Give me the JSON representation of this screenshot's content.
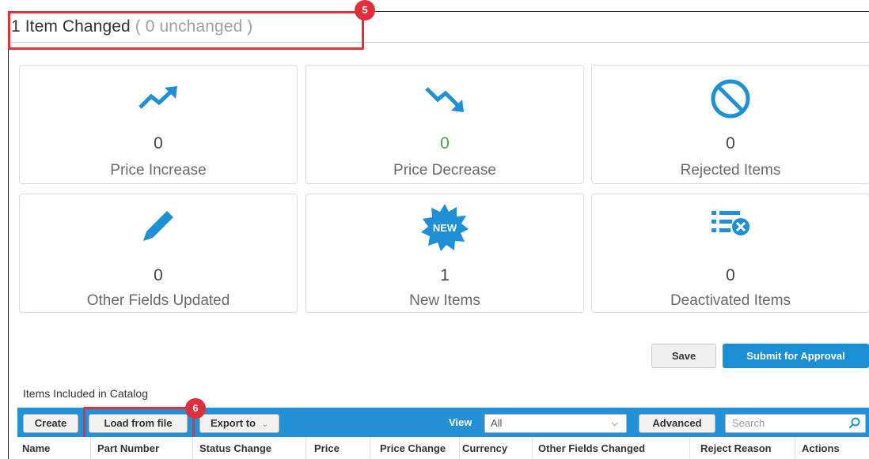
{
  "header": {
    "title_main": "1 Item Changed",
    "title_sub": " ( 0 unchanged )"
  },
  "callouts": [
    "5",
    "6"
  ],
  "tiles": [
    {
      "icon": "trend-up-icon",
      "count": "0",
      "label": "Price Increase"
    },
    {
      "icon": "trend-down-icon",
      "count": "0",
      "label": "Price Decrease"
    },
    {
      "icon": "prohibited-icon",
      "count": "0",
      "label": "Rejected Items"
    },
    {
      "icon": "pencil-icon",
      "count": "0",
      "label": "Other Fields Updated"
    },
    {
      "icon": "new-badge-icon",
      "count": "1",
      "label": "New Items",
      "badge_text": "NEW"
    },
    {
      "icon": "list-remove-icon",
      "count": "0",
      "label": "Deactivated Items"
    }
  ],
  "actions": {
    "save_label": "Save",
    "submit_label": "Submit for Approval"
  },
  "section_label": "Items Included in Catalog",
  "toolbar": {
    "create_label": "Create",
    "load_label": "Load from file",
    "export_label": "Export to",
    "view_label": "View",
    "view_value": "All",
    "advanced_label": "Advanced",
    "search_placeholder": "Search"
  },
  "table": {
    "columns": [
      "Name",
      "Part Number",
      "Status Change",
      "Price",
      "Price Change",
      "Currency",
      "Other Fields Changed",
      "Reject Reason",
      "Actions"
    ]
  },
  "colors": {
    "accent_blue": "#1c8ed4",
    "toolbar_blue": "#2491d6",
    "callout_red": "#e0303e",
    "positive_green": "#4ca24a"
  }
}
